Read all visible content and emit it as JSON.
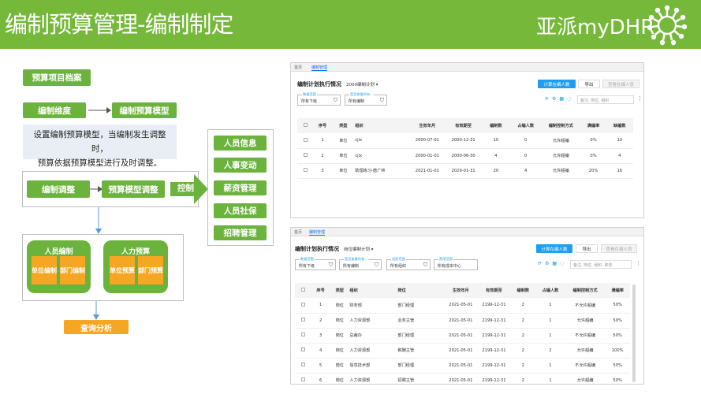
{
  "banner": {
    "title": "编制预算管理-编制制定",
    "brand": "亚派myDHR",
    "bg_color": "#75b83a"
  },
  "diagram": {
    "archive": "预算项目档案",
    "dimension": "编制维度",
    "model": "编制预算模型",
    "note_line1": "设置编制预算模型，当编制发生调整时，",
    "note_line2": "预算依据预算模型进行及时调整。",
    "adjust": "编制调整",
    "model_adjust": "预算模型调整",
    "control": "控制",
    "targets": [
      "人员信息",
      "人事变动",
      "薪资管理",
      "人员社保",
      "招聘管理"
    ],
    "staffing": {
      "title": "人员编制",
      "unit": "单位编制",
      "dept": "部门编制"
    },
    "budget": {
      "title": "人力预算",
      "unit": "单位预算",
      "dept": "部门预算"
    },
    "query": "查询分析",
    "green": "#6cb33e",
    "orange": "#f5a623"
  },
  "panel1": {
    "tabs": [
      "首页",
      "编制管理"
    ],
    "title": "编制计划执行情况",
    "plan_select": "2000编制计划",
    "btn_calc": "计算在编人数",
    "btn_export": "导出",
    "btn_view": "查看在编人员",
    "filter1_label": "数据范围",
    "filter1_value": "所有下级",
    "filter2_label": "是否查看所有...",
    "filter2_value": "所有编制",
    "search_placeholder": "备注, 岗位, 组织",
    "headers": [
      "序号",
      "类型",
      "组织",
      "生效年月",
      "有效期至",
      "编制数",
      "占编人数",
      "编制控制方式",
      "满编率",
      "缺编数"
    ],
    "rows": [
      [
        "1",
        "单位",
        "cjlx",
        "2000-07-01",
        "2000-12-31",
        "10",
        "0",
        "允许超编",
        "0%",
        "10"
      ],
      [
        "2",
        "单位",
        "cjlx",
        "2000-01-01",
        "2000-06-30",
        "4",
        "0",
        "允许超编",
        "0%",
        "4"
      ],
      [
        "3",
        "单位",
        "助理练习-唐广林",
        "2021-01-01",
        "2029-01-31",
        "20",
        "4",
        "允许超编",
        "20%",
        "16"
      ]
    ]
  },
  "panel2": {
    "tabs": [
      "首页",
      "编制管理"
    ],
    "title": "编制计划执行情况",
    "plan_select": "岗位编制计划",
    "btn_calc": "计算在编人数",
    "btn_export": "导出",
    "btn_view": "查看在编人员",
    "filter1_label": "数据范围",
    "filter1_value": "所有下级",
    "filter2_label": "是否查看所有...",
    "filter2_value": "所有编制",
    "filter3_label": "组织范围",
    "filter3_value": "所有组织",
    "filter4_label": "费用范围",
    "filter4_value": "所有成本中心",
    "search_placeholder": "备注, 岗位, 组织, 职务",
    "headers": [
      "序号",
      "类型",
      "组织",
      "岗位",
      "生效年月",
      "有效期至",
      "编制数",
      "占编人数",
      "编制控制方式",
      "满编率"
    ],
    "rows": [
      [
        "1",
        "岗位",
        "财务部",
        "部门经理",
        "2021-05-01",
        "2199-12-31",
        "2",
        "1",
        "不允许超编",
        "50%"
      ],
      [
        "2",
        "岗位",
        "人力资源部",
        "业务主管",
        "2021-05-01",
        "2199-12-31",
        "2",
        "1",
        "允许超编",
        "50%"
      ],
      [
        "3",
        "岗位",
        "总裁办",
        "部门经理",
        "2021-05-01",
        "2199-12-31",
        "2",
        "1",
        "不允许超编",
        "50%"
      ],
      [
        "4",
        "岗位",
        "人力资源部",
        "薪酬主管",
        "2021-05-01",
        "2199-12-31",
        "2",
        "2",
        "允许超编",
        "100%"
      ],
      [
        "5",
        "岗位",
        "信息技术部",
        "部门经理",
        "2021-05-01",
        "2199-12-31",
        "2",
        "1",
        "不允许超编",
        "50%"
      ],
      [
        "6",
        "岗位",
        "人力资源部",
        "招聘主管",
        "2021-05-01",
        "2199-12-31",
        "2",
        "1",
        "允许超编",
        "50%"
      ]
    ]
  }
}
